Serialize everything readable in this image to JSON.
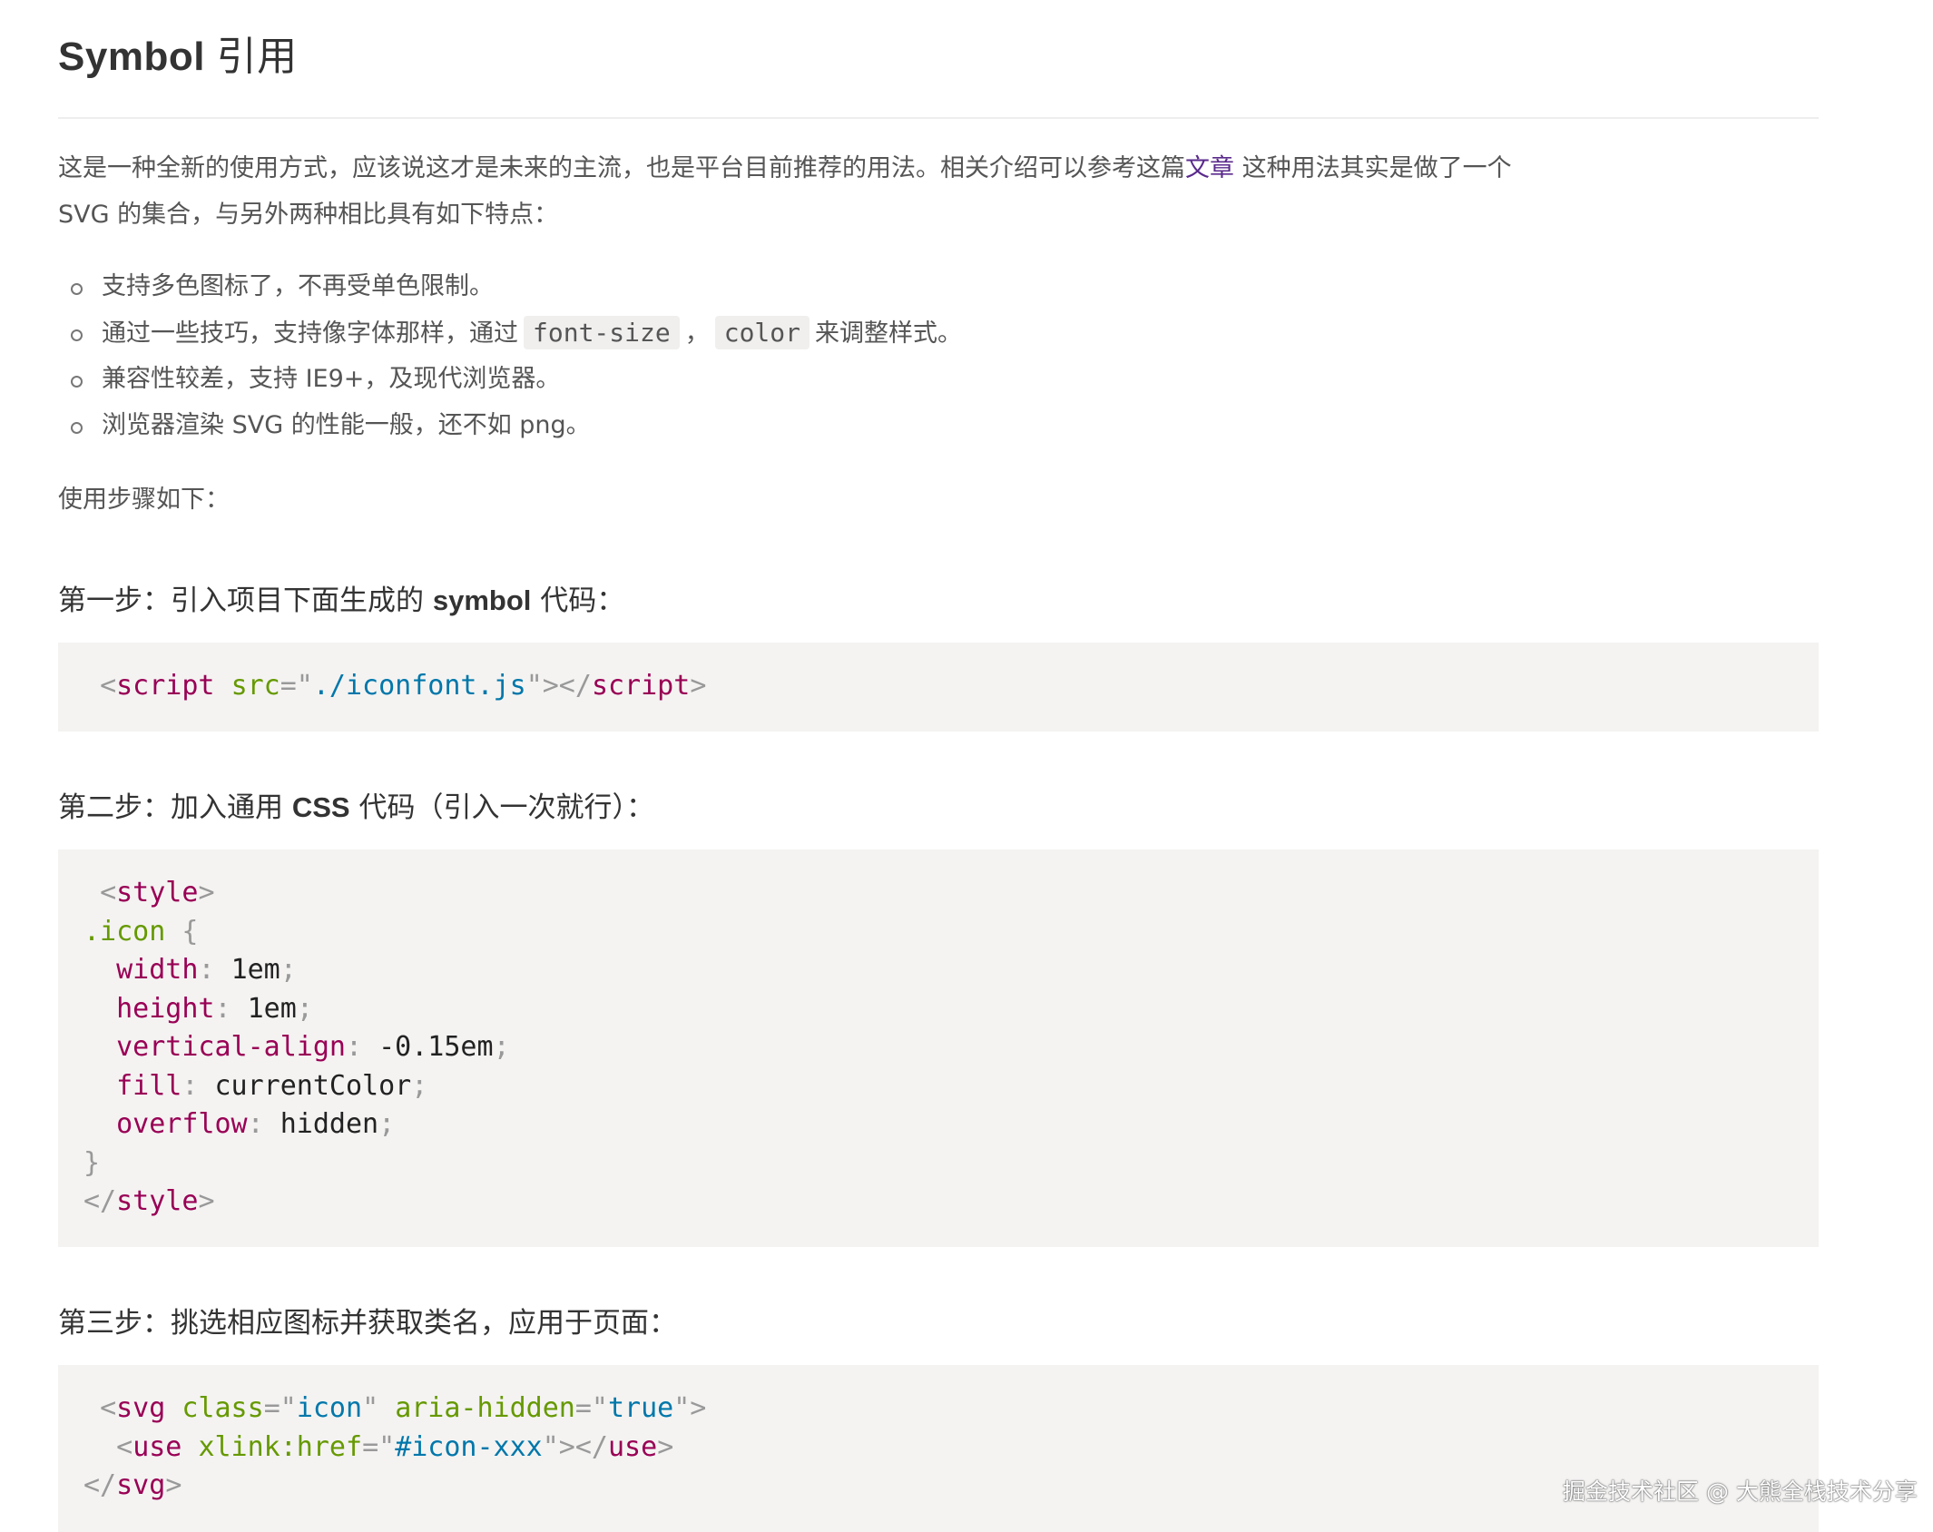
{
  "title": {
    "latin": "Symbol",
    "cjk": "引用"
  },
  "intro": {
    "text_before_link": "这是一种全新的使用方式，应该说这才是未来的主流，也是平台目前推荐的用法。相关介绍可以参考这篇",
    "link": "文章",
    "text_after_link": " 这种用法其实是做了一个 SVG 的集合，与另外两种相比具有如下特点："
  },
  "features": [
    {
      "text": "支持多色图标了，不再受单色限制。"
    },
    {
      "before": "通过一些技巧，支持像字体那样，通过",
      "code1": "font-size",
      "sep": "，",
      "code2": "color",
      "after": "来调整样式。"
    },
    {
      "text": "兼容性较差，支持 IE9+，及现代浏览器。"
    },
    {
      "text": "浏览器渲染 SVG 的性能一般，还不如 png。"
    }
  ],
  "steps_intro": "使用步骤如下：",
  "steps": [
    {
      "before": "第一步：引入项目下面生成的 ",
      "bold": "symbol",
      "after": " 代码："
    },
    {
      "before": "第二步：加入通用 ",
      "bold": "CSS",
      "after": " 代码（引入一次就行）："
    },
    {
      "text": "第三步：挑选相应图标并获取类名，应用于页面："
    }
  ],
  "code1": {
    "tag": "script",
    "attr": "src",
    "value": "./iconfont.js"
  },
  "code2": {
    "open_tag": "style",
    "selector": ".icon",
    "open_brace": "{",
    "rules": [
      {
        "prop": "width",
        "value": "1em"
      },
      {
        "prop": "height",
        "value": "1em"
      },
      {
        "prop": "vertical-align",
        "value": "-0.15em"
      },
      {
        "prop": "fill",
        "value": "currentColor"
      },
      {
        "prop": "overflow",
        "value": "hidden"
      }
    ],
    "close_brace": "}",
    "close_tag": "style"
  },
  "code3": {
    "svg_tag": "svg",
    "class_attr": "class",
    "class_value": "icon",
    "aria_attr": "aria-hidden",
    "aria_value": "true",
    "use_tag": "use",
    "href_attr": "xlink:href",
    "href_value": "#icon-xxx"
  },
  "watermark": "掘金技术社区 @ 大熊全栈技术分享"
}
